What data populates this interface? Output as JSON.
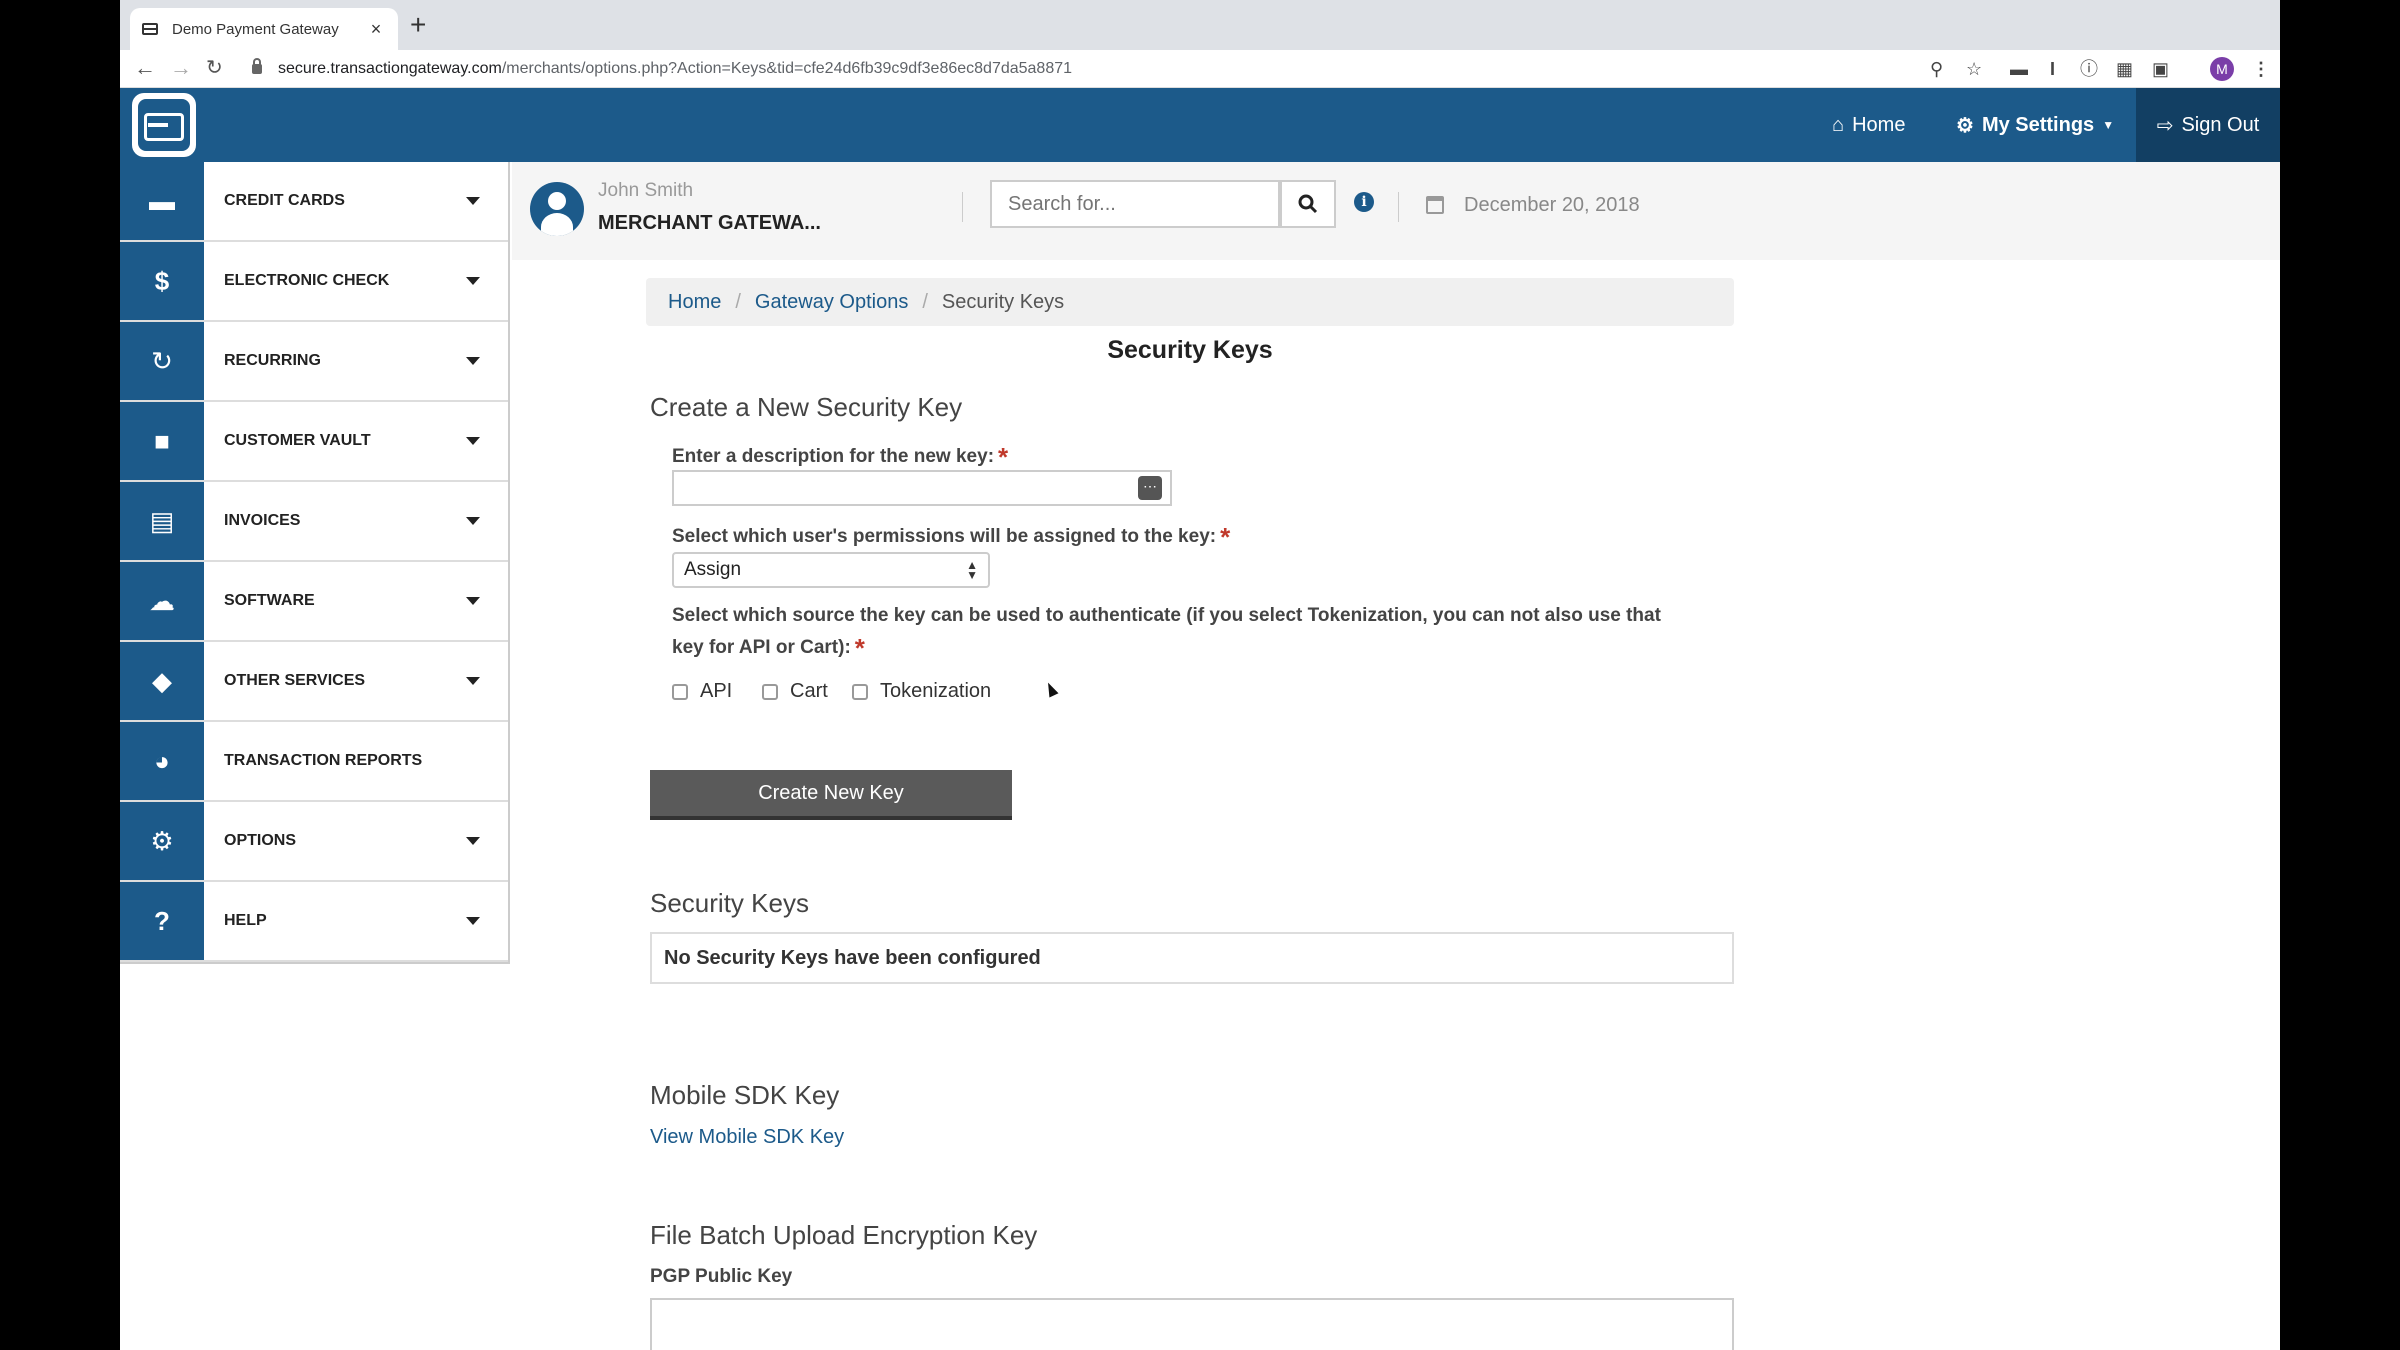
{
  "browser": {
    "tab_title": "Demo Payment Gateway",
    "tab_close": "×",
    "new_tab": "+",
    "url_host": "secure.transactiongateway.com",
    "url_path": "/merchants/options.php?Action=Keys&tid=cfe24d6fb39c9df3e86ec8d7da5a8871",
    "profile_initial": "M"
  },
  "header": {
    "home_label": "Home",
    "settings_label": "My Settings",
    "signout_label": "Sign Out"
  },
  "sidebar": {
    "items": [
      {
        "label": "CREDIT CARDS",
        "icon": "credit-card-icon",
        "dropdown": true
      },
      {
        "label": "ELECTRONIC CHECK",
        "icon": "dollar-icon",
        "dropdown": true
      },
      {
        "label": "RECURRING",
        "icon": "refresh-icon",
        "dropdown": true
      },
      {
        "label": "CUSTOMER VAULT",
        "icon": "lock-icon",
        "dropdown": true
      },
      {
        "label": "INVOICES",
        "icon": "invoice-icon",
        "dropdown": true
      },
      {
        "label": "SOFTWARE",
        "icon": "cloud-icon",
        "dropdown": true
      },
      {
        "label": "OTHER SERVICES",
        "icon": "tags-icon",
        "dropdown": true
      },
      {
        "label": "TRANSACTION REPORTS",
        "icon": "pie-chart-icon",
        "dropdown": false
      },
      {
        "label": "OPTIONS",
        "icon": "cogs-icon",
        "dropdown": true
      },
      {
        "label": "HELP",
        "icon": "question-icon",
        "dropdown": true
      }
    ]
  },
  "userbar": {
    "user_name": "John Smith",
    "merchant_name": "MERCHANT GATEWA...",
    "search_placeholder": "Search for...",
    "date": "December 20, 2018"
  },
  "breadcrumb": {
    "home": "Home",
    "gateway_options": "Gateway Options",
    "current": "Security Keys"
  },
  "page": {
    "title": "Security Keys",
    "create_heading": "Create a New Security Key",
    "desc_label": "Enter a description for the new key:",
    "desc_value": "",
    "perm_label": "Select which user's permissions will be assigned to the key:",
    "perm_selected": "Assign",
    "source_label_line1": "Select which source the key can be used to authenticate (if you select Tokenization, you can not also use that",
    "source_label_line2": "key for API or Cart):",
    "required_mark": "*",
    "checkboxes": [
      {
        "label": "API",
        "checked": false
      },
      {
        "label": "Cart",
        "checked": false
      },
      {
        "label": "Tokenization",
        "checked": false
      }
    ],
    "create_button": "Create New Key",
    "keys_heading": "Security Keys",
    "no_keys_text": "No Security Keys have been configured",
    "sdk_heading": "Mobile SDK Key",
    "sdk_link": "View Mobile SDK Key",
    "batch_heading": "File Batch Upload Encryption Key",
    "pgp_label": "PGP Public Key",
    "pgp_value": ""
  },
  "colors": {
    "brand": "#1c5a8a",
    "brand_dark": "#123f63",
    "required": "#c0392b",
    "button": "#5a5a5a"
  }
}
